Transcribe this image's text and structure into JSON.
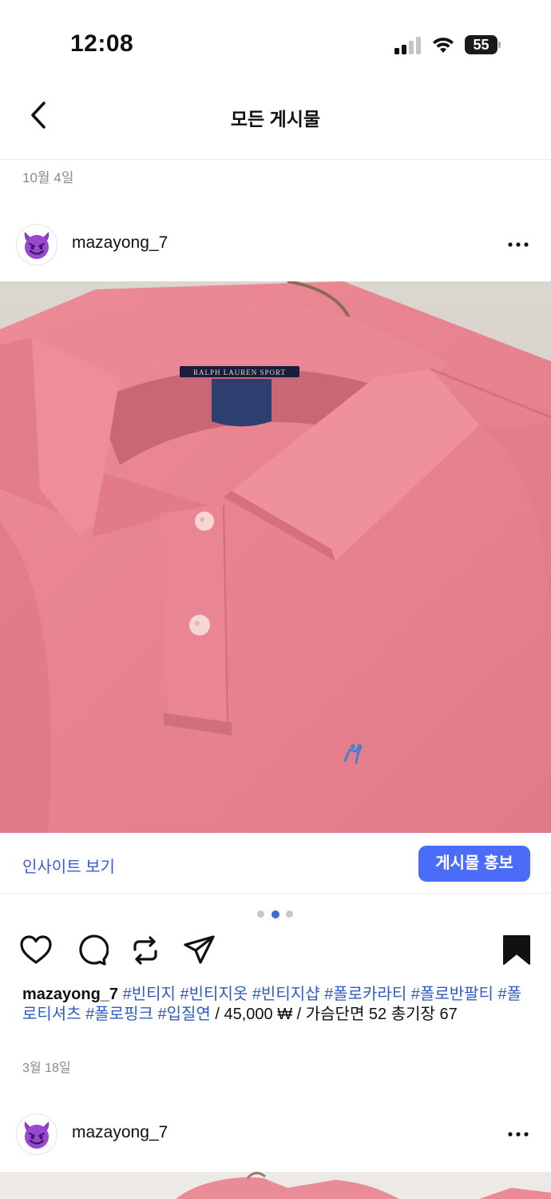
{
  "status_bar": {
    "time": "12:08",
    "battery": "55"
  },
  "nav": {
    "title": "모든 게시물"
  },
  "date_top": "10월 4일",
  "post": {
    "username": "mazayong_7",
    "avatar_emoji": "😈",
    "insight_label": "인사이트 보기",
    "promote_label": "게시물 홍보",
    "carousel": {
      "count": 3,
      "active_index": 1
    },
    "caption": {
      "username": "mazayong_7",
      "hashtags": [
        "#빈티지",
        "#빈티지옷",
        "#빈티지샵",
        "#폴로카라티",
        "#폴로반팔티",
        "#폴로티셔츠",
        "#폴로핑크",
        "#입질연"
      ],
      "text": "/ 45,000 ₩ / 가슴단면 52 총기장 67"
    },
    "date": "3월 18일"
  },
  "next_post": {
    "username": "mazayong_7",
    "avatar_emoji": "😈"
  },
  "colors": {
    "accent": "#4a6cf7",
    "link": "#3a5bd6",
    "hashtag": "#2f5bc4",
    "shirt": "#e9818e"
  },
  "icons": [
    "back-icon",
    "more-icon",
    "heart-icon",
    "comment-icon",
    "repost-icon",
    "share-icon",
    "bookmark-icon"
  ]
}
